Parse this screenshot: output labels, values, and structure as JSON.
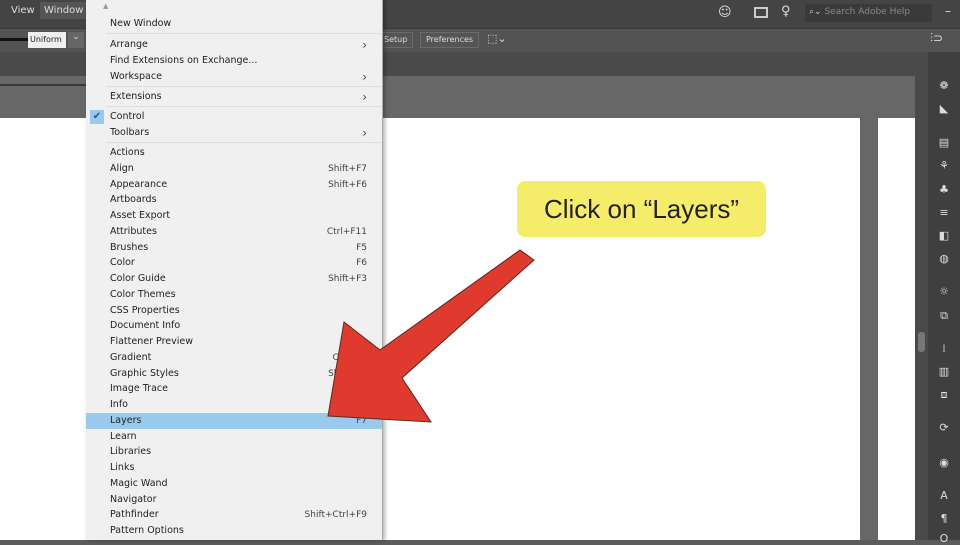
{
  "menubar": {
    "items": [
      "View",
      "Window"
    ],
    "search_placeholder": "Search Adobe Help"
  },
  "control_bar": {
    "stroke_profile": "Uniform",
    "buttons": [
      "Setup",
      "Preferences"
    ]
  },
  "window_menu": {
    "items": [
      {
        "label": "New Window",
        "y": 23
      },
      {
        "label": "Arrange",
        "submenu": true
      },
      {
        "label": "Find Extensions on Exchange..."
      },
      {
        "label": "Workspace",
        "submenu": true
      },
      {
        "label": "Extensions",
        "submenu": true
      },
      {
        "label": "Control",
        "checked": true
      },
      {
        "label": "Toolbars",
        "submenu": true
      },
      {
        "label": "Actions"
      },
      {
        "label": "Align",
        "shortcut": "Shift+F7"
      },
      {
        "label": "Appearance",
        "shortcut": "Shift+F6"
      },
      {
        "label": "Artboards"
      },
      {
        "label": "Asset Export"
      },
      {
        "label": "Attributes",
        "shortcut": "Ctrl+F11"
      },
      {
        "label": "Brushes",
        "shortcut": "F5"
      },
      {
        "label": "Color",
        "shortcut": "F6"
      },
      {
        "label": "Color Guide",
        "shortcut": "Shift+F3"
      },
      {
        "label": "Color Themes"
      },
      {
        "label": "CSS Properties"
      },
      {
        "label": "Document Info"
      },
      {
        "label": "Flattener Preview"
      },
      {
        "label": "Gradient",
        "shortcut": "Ctrl+F9"
      },
      {
        "label": "Graphic Styles",
        "shortcut": "Shift+F5"
      },
      {
        "label": "Image Trace"
      },
      {
        "label": "Info"
      },
      {
        "label": "Layers",
        "shortcut": "F7",
        "highlighted": true
      },
      {
        "label": "Learn"
      },
      {
        "label": "Libraries"
      },
      {
        "label": "Links"
      },
      {
        "label": "Magic Wand"
      },
      {
        "label": "Navigator"
      },
      {
        "label": "Pathfinder",
        "shortcut": "Shift+Ctrl+F9"
      },
      {
        "label": "Pattern Options"
      }
    ]
  },
  "callout": {
    "text": "Click on “Layers”",
    "color": "#f5ec6a"
  },
  "arrow": {
    "color": "#e03a2e"
  },
  "colors": {
    "highlight": "#99c9ec"
  }
}
